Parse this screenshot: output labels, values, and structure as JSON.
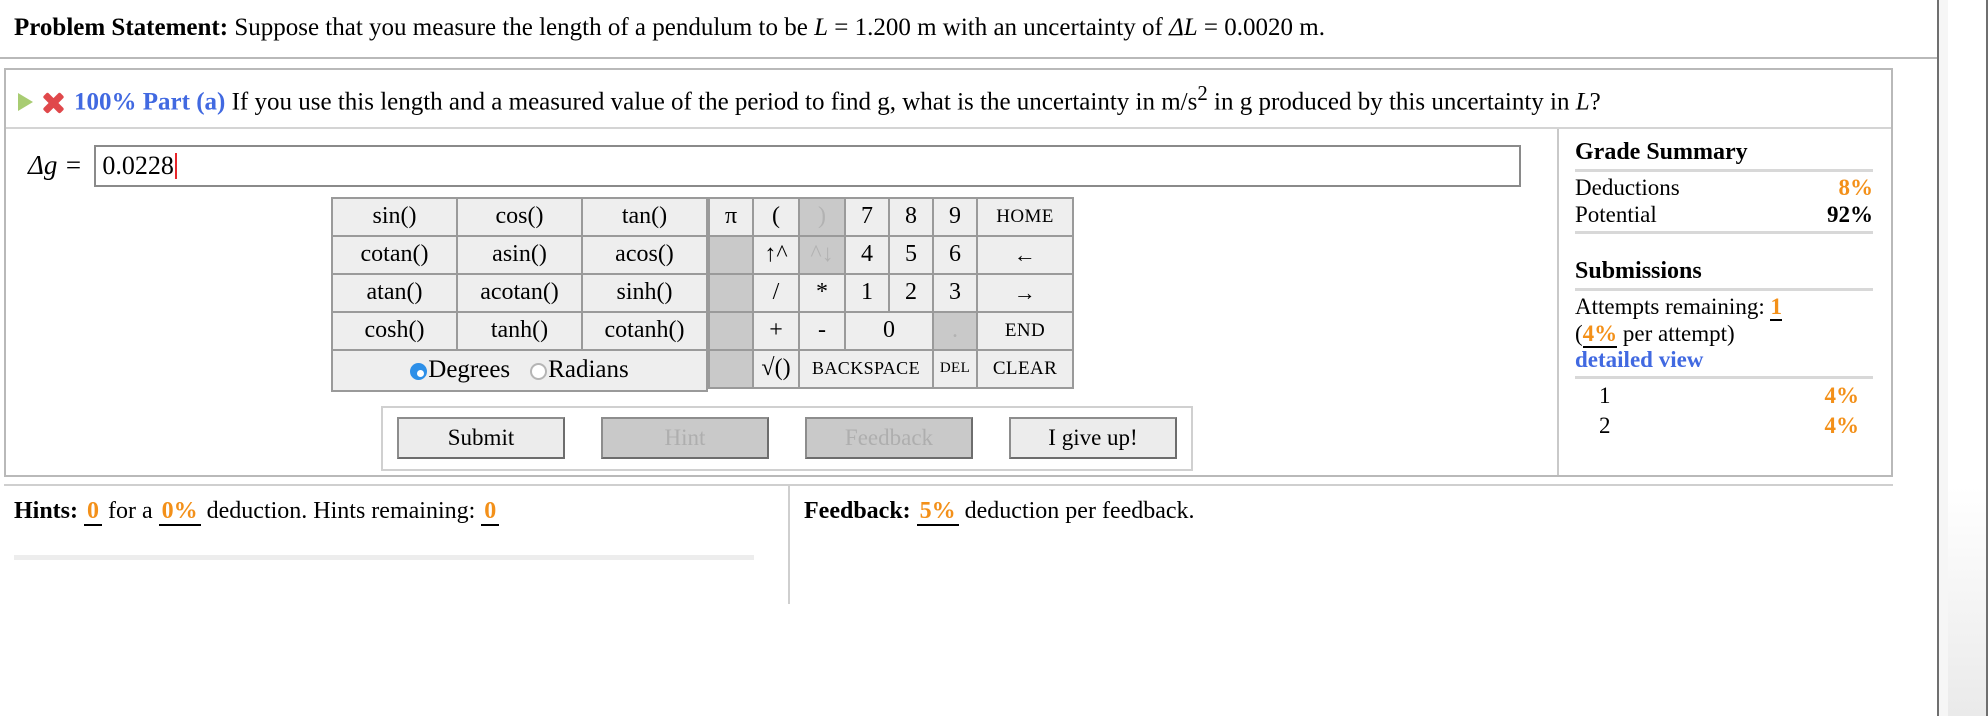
{
  "statement": {
    "label": "Problem Statement:",
    "text_1": " Suppose that you measure the length of a pendulum to be ",
    "var_L": "L",
    "text_2": " = 1.200 m with an uncertainty of ",
    "var_dL": "ΔL",
    "text_3": " = 0.0020 m."
  },
  "part": {
    "play_icon": "play-triangle-icon",
    "status_icon": "incorrect-x-icon",
    "percent_label": "100% Part (a)",
    "question_1": "  If you use this length and a measured value of the period to find g, what is the uncertainty in m/s",
    "question_sup": "2",
    "question_2": " in g produced by this uncertainty in ",
    "question_var": "L",
    "question_3": "?"
  },
  "answer": {
    "label": "Δg =",
    "value": "0.0228",
    "placeholder": ""
  },
  "calculator": {
    "functions": [
      [
        "sin()",
        "cos()",
        "tan()"
      ],
      [
        "cotan()",
        "asin()",
        "acos()"
      ],
      [
        "atan()",
        "acotan()",
        "sinh()"
      ],
      [
        "cosh()",
        "tanh()",
        "cotanh()"
      ]
    ],
    "mode_degrees": "Degrees",
    "mode_radians": "Radians",
    "mode_selected": "Degrees",
    "keys": {
      "pi": "π",
      "open_paren": "(",
      "close_paren": ")",
      "pow_up": "↑^",
      "pow_down": "^↓",
      "divide": "/",
      "multiply": "*",
      "plus": "+",
      "minus": "-",
      "sqrt": "√()",
      "d7": "7",
      "d8": "8",
      "d9": "9",
      "d4": "4",
      "d5": "5",
      "d6": "6",
      "d1": "1",
      "d2": "2",
      "d3": "3",
      "d0": "0",
      "dot": ".",
      "home": "HOME",
      "left": "←",
      "right": "→",
      "end": "END",
      "backspace": "BACKSPACE",
      "del": "DEL",
      "clear": "CLEAR"
    },
    "disabled_keys": [
      "close_paren",
      "pow_down",
      "dot"
    ]
  },
  "actions": {
    "submit": "Submit",
    "hint": "Hint",
    "feedback": "Feedback",
    "give_up": "I give up!",
    "disabled": [
      "hint",
      "feedback"
    ]
  },
  "grade_summary": {
    "title": "Grade Summary",
    "deductions_label": "Deductions",
    "deductions_value": "8%",
    "potential_label": "Potential",
    "potential_value": "92%",
    "submissions_title": "Submissions",
    "attempts_label": "Attempts remaining:",
    "attempts_value": "1",
    "per_attempt_open": "(",
    "per_attempt_value": "4%",
    "per_attempt_text": " per attempt)",
    "detailed_view": "detailed view",
    "attempts": [
      {
        "n": "1",
        "pct": "4%"
      },
      {
        "n": "2",
        "pct": "4%"
      }
    ]
  },
  "bottom": {
    "hints_label": "Hints:",
    "hints_count": "0",
    "hints_for_a": "for a",
    "hints_deduction": "0%",
    "hints_deduction_text": "deduction. Hints remaining:",
    "hints_remaining": "0",
    "feedback_label": "Feedback:",
    "feedback_deduction": "5%",
    "feedback_text": "deduction per feedback."
  },
  "colors": {
    "accent_blue": "#4169e1",
    "accent_orange": "#f39019",
    "correct_green": "#a8cc72",
    "incorrect_red": "#e0484b",
    "radio_blue": "#2d8fe8"
  }
}
